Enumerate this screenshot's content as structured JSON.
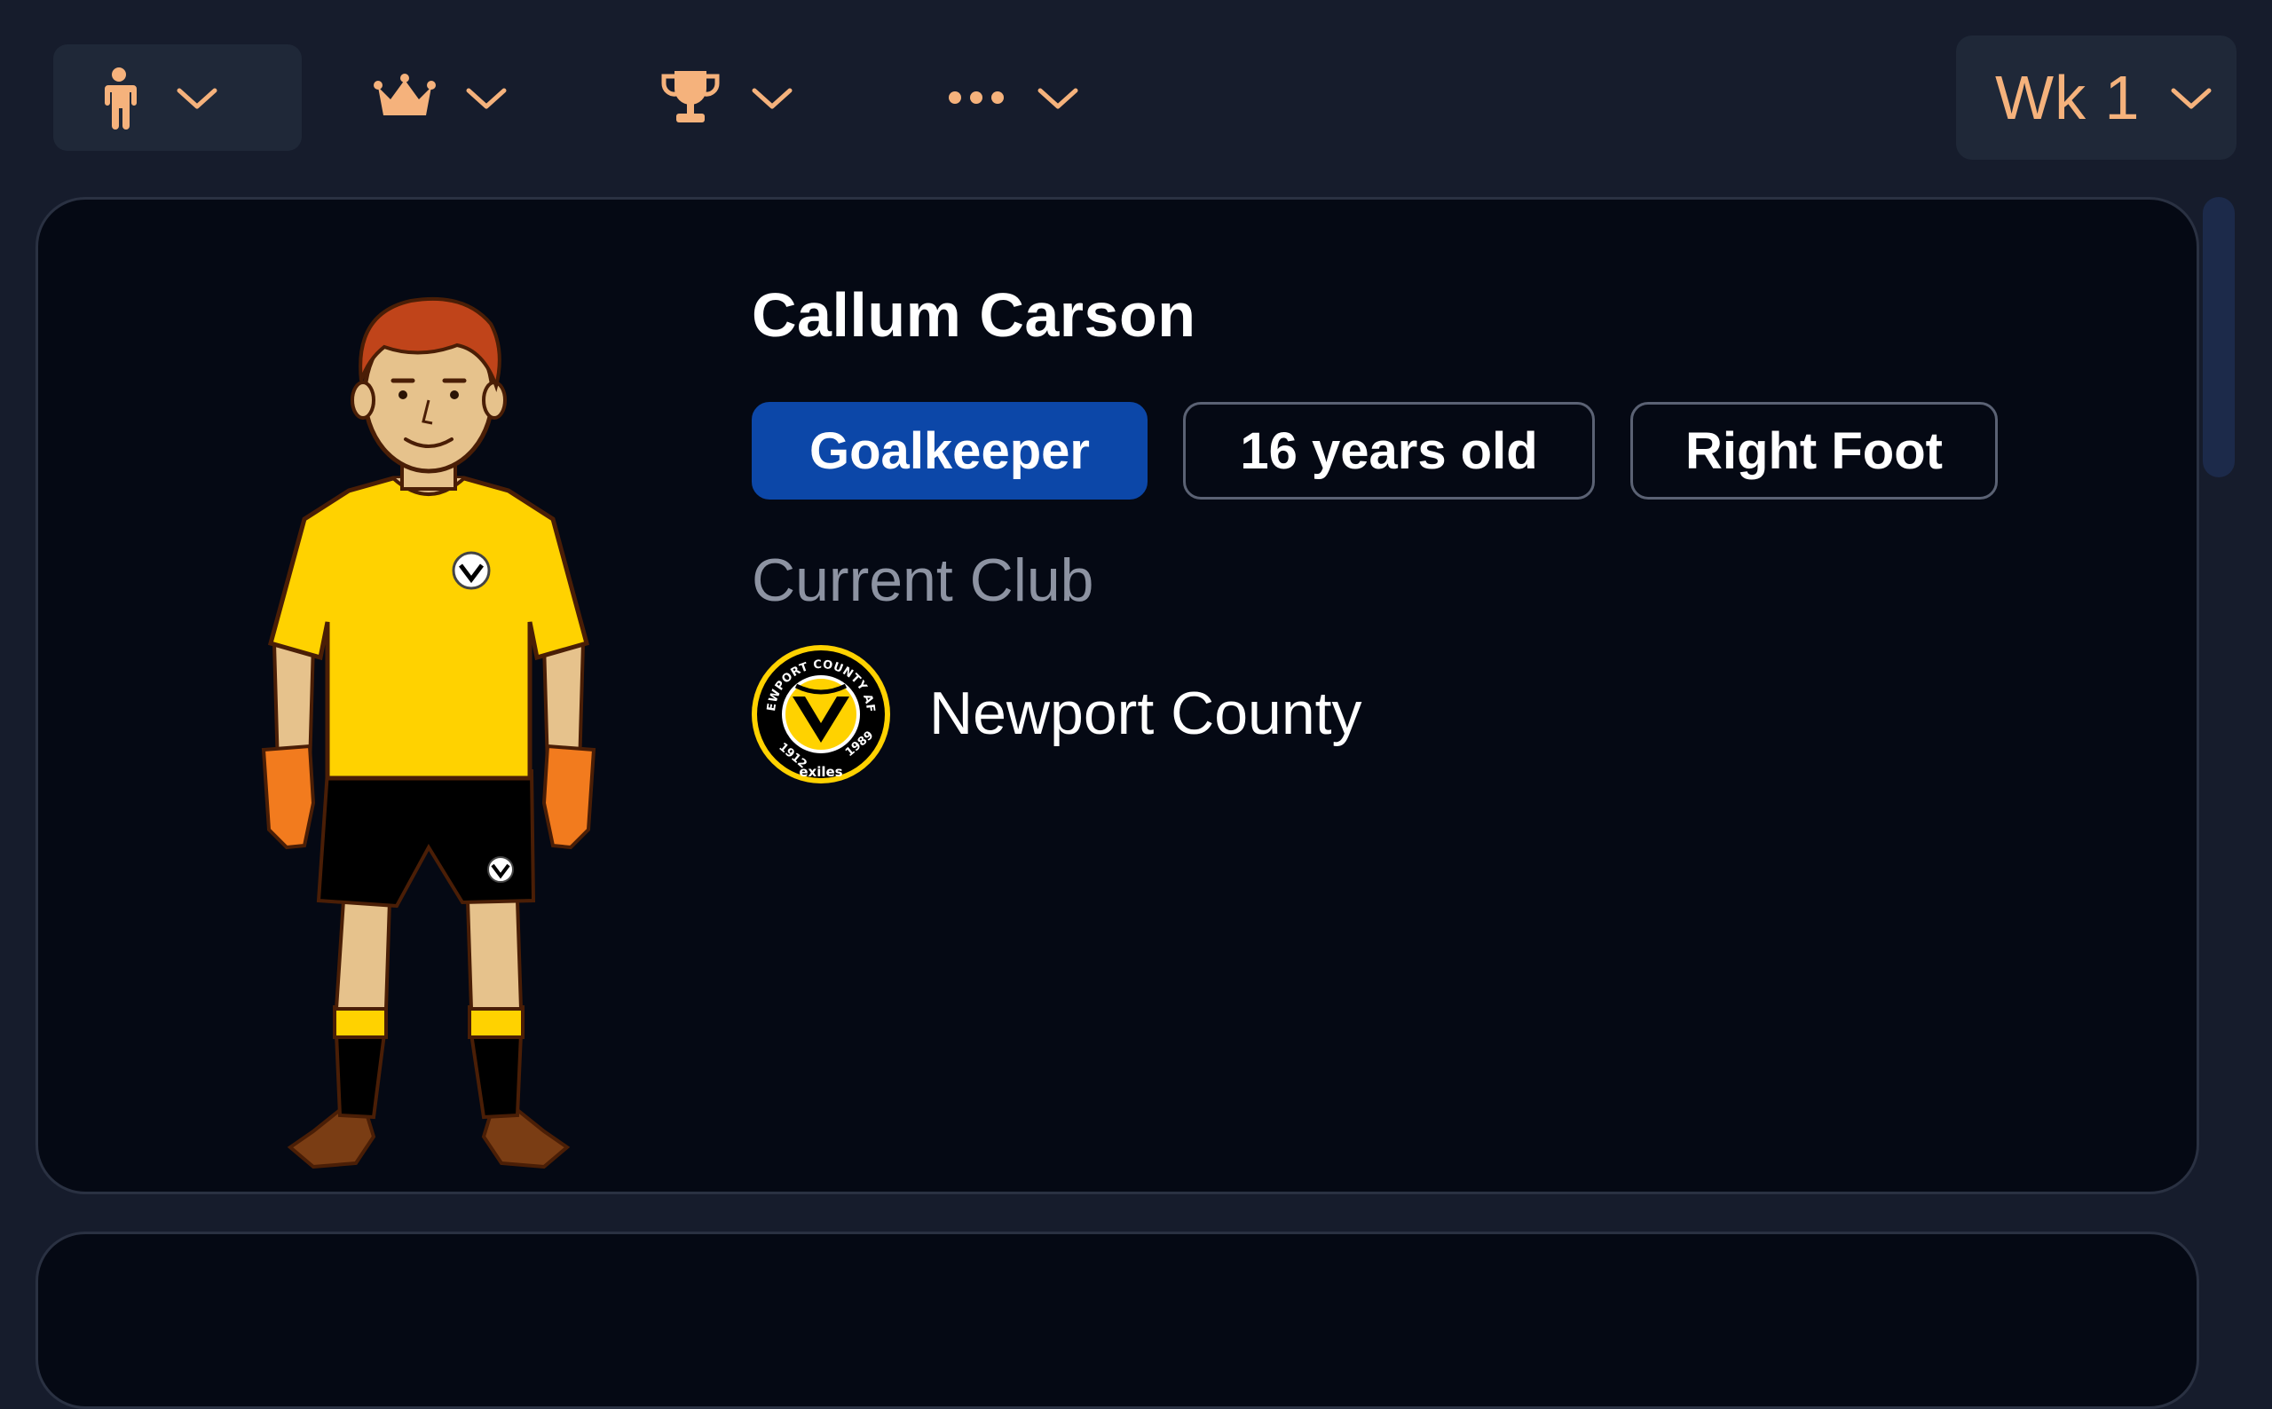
{
  "toolbar": {
    "tabs": [
      {
        "icon": "person-icon",
        "active": true
      },
      {
        "icon": "crown-icon",
        "active": false
      },
      {
        "icon": "trophy-icon",
        "active": false
      },
      {
        "icon": "more-icon",
        "active": false
      }
    ],
    "week_label": "Wk 1"
  },
  "player": {
    "name": "Callum Carson",
    "position": "Goalkeeper",
    "age": "16 years old",
    "foot": "Right Foot"
  },
  "club": {
    "heading": "Current Club",
    "name": "Newport County",
    "crest_text_top": "NEWPORT COUNTY AFC",
    "crest_text_left": "1912",
    "crest_text_right": "1989",
    "crest_text_bottom": "exiles"
  },
  "colors": {
    "accent": "#f5b27c",
    "background": "#161c2c",
    "card": "#050914",
    "position_pill": "#0c47a8",
    "kit_shirt": "#ffd200",
    "kit_shorts": "#000000"
  }
}
